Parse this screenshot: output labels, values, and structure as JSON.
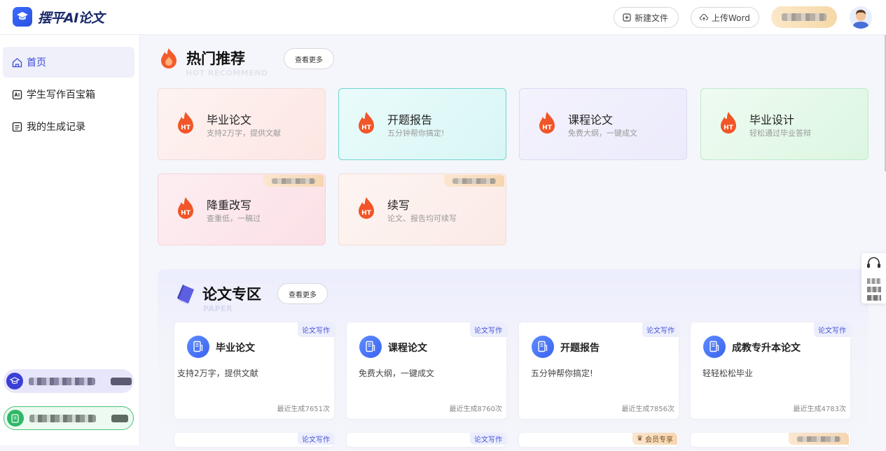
{
  "app": {
    "name": "摆平AI论文"
  },
  "toolbar": {
    "new_file": "新建文件",
    "upload_word": "上传Word"
  },
  "sidebar": {
    "items": [
      {
        "label": "首页",
        "icon": "home-icon",
        "active": true
      },
      {
        "label": "学生写作百宝箱",
        "icon": "toolbox-icon",
        "active": false
      },
      {
        "label": "我的生成记录",
        "icon": "record-icon",
        "active": false
      }
    ]
  },
  "hot": {
    "title": "热门推荐",
    "subtitle": "HOT RECOMMEND",
    "more": "查看更多",
    "cards": [
      {
        "title": "毕业论文",
        "desc": "支持2万字，提供文献"
      },
      {
        "title": "开题报告",
        "desc": "五分钟帮你搞定!"
      },
      {
        "title": "课程论文",
        "desc": "免费大纲，一键成文"
      },
      {
        "title": "毕业设计",
        "desc": "轻松通过毕业答辩"
      },
      {
        "title": "降重改写",
        "desc": "查重低，一稿过"
      },
      {
        "title": "续写",
        "desc": "论文、报告均可续写"
      }
    ],
    "flame_badge": "HT"
  },
  "paper": {
    "title": "论文专区",
    "subtitle": "PAPER",
    "more": "查看更多",
    "badge": "论文写作",
    "cards": [
      {
        "title": "毕业论文",
        "desc": "支持2万字，提供文献",
        "stat": "最近生成7651次"
      },
      {
        "title": "课程论文",
        "desc": "免费大纲，一键成文",
        "stat": "最近生成8760次"
      },
      {
        "title": "开题报告",
        "desc": "五分钟帮你搞定!",
        "stat": "最近生成7856次"
      },
      {
        "title": "成教专升本论文",
        "desc": "轻轻松松毕业",
        "stat": "最近生成4783次"
      }
    ],
    "member_badge": "会员专享"
  },
  "colors": {
    "accent": "#3b4bd9",
    "flame": "#f0512a",
    "vip": "#f6d6b0"
  }
}
